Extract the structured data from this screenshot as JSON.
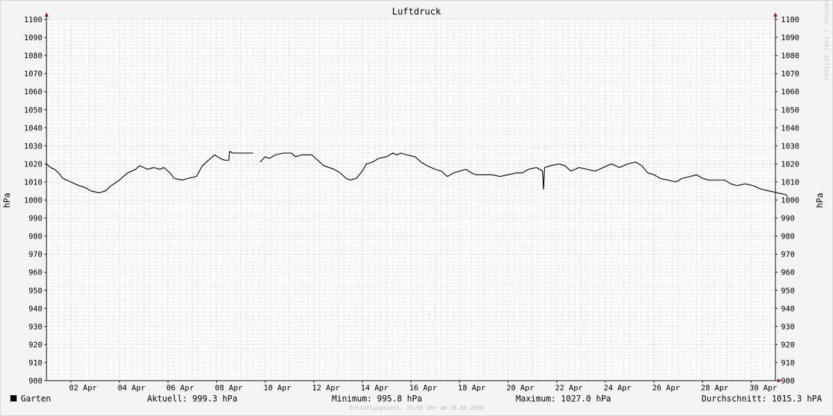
{
  "chart_data": {
    "type": "line",
    "title": "Luftdruck",
    "ylabel": "hPa",
    "ylim": [
      900,
      1100
    ],
    "yticks": [
      900,
      910,
      920,
      930,
      940,
      950,
      960,
      970,
      980,
      990,
      1000,
      1010,
      1020,
      1030,
      1040,
      1050,
      1060,
      1070,
      1080,
      1090,
      1100
    ],
    "x_range_days": [
      "2020-04-01",
      "2020-05-01"
    ],
    "xticks": [
      {
        "day": "2020-04-02",
        "label": "02 Apr"
      },
      {
        "day": "2020-04-04",
        "label": "04 Apr"
      },
      {
        "day": "2020-04-06",
        "label": "06 Apr"
      },
      {
        "day": "2020-04-08",
        "label": "08 Apr"
      },
      {
        "day": "2020-04-10",
        "label": "10 Apr"
      },
      {
        "day": "2020-04-12",
        "label": "12 Apr"
      },
      {
        "day": "2020-04-14",
        "label": "14 Apr"
      },
      {
        "day": "2020-04-16",
        "label": "16 Apr"
      },
      {
        "day": "2020-04-18",
        "label": "18 Apr"
      },
      {
        "day": "2020-04-20",
        "label": "20 Apr"
      },
      {
        "day": "2020-04-22",
        "label": "22 Apr"
      },
      {
        "day": "2020-04-24",
        "label": "24 Apr"
      },
      {
        "day": "2020-04-26",
        "label": "26 Apr"
      },
      {
        "day": "2020-04-28",
        "label": "28 Apr"
      },
      {
        "day": "2020-04-30",
        "label": "30 Apr"
      }
    ],
    "grid": true,
    "series": [
      {
        "name": "Garten",
        "color": "#000000",
        "segments": [
          [
            [
              "2020-04-01 00:00",
              1020
            ],
            [
              "2020-04-01 04:00",
              1018
            ],
            [
              "2020-04-01 08:00",
              1017
            ],
            [
              "2020-04-01 12:00",
              1015
            ],
            [
              "2020-04-01 16:00",
              1012
            ],
            [
              "2020-04-02 00:00",
              1010
            ],
            [
              "2020-04-02 08:00",
              1008
            ],
            [
              "2020-04-02 14:00",
              1007
            ],
            [
              "2020-04-02 20:00",
              1005
            ],
            [
              "2020-04-03 04:00",
              1004
            ],
            [
              "2020-04-03 10:00",
              1005
            ],
            [
              "2020-04-03 16:00",
              1008
            ],
            [
              "2020-04-04 00:00",
              1011
            ],
            [
              "2020-04-04 08:00",
              1015
            ],
            [
              "2020-04-04 16:00",
              1017
            ],
            [
              "2020-04-04 20:00",
              1019
            ],
            [
              "2020-04-05 04:00",
              1017
            ],
            [
              "2020-04-05 10:00",
              1018
            ],
            [
              "2020-04-05 16:00",
              1017
            ],
            [
              "2020-04-05 20:00",
              1018
            ],
            [
              "2020-04-06 02:00",
              1015
            ],
            [
              "2020-04-06 06:00",
              1012
            ],
            [
              "2020-04-06 14:00",
              1011
            ],
            [
              "2020-04-06 20:00",
              1012
            ],
            [
              "2020-04-07 04:00",
              1013
            ],
            [
              "2020-04-07 10:00",
              1019
            ],
            [
              "2020-04-07 16:00",
              1022
            ],
            [
              "2020-04-07 22:00",
              1025
            ],
            [
              "2020-04-08 04:00",
              1023
            ],
            [
              "2020-04-08 08:00",
              1022
            ],
            [
              "2020-04-08 12:00",
              1022
            ],
            [
              "2020-04-08 13:00",
              1027
            ],
            [
              "2020-04-08 16:00",
              1026
            ],
            [
              "2020-04-09 12:00",
              1026
            ]
          ],
          [
            [
              "2020-04-09 19:00",
              1021
            ],
            [
              "2020-04-10 00:00",
              1024
            ],
            [
              "2020-04-10 04:00",
              1023
            ],
            [
              "2020-04-10 10:00",
              1025
            ],
            [
              "2020-04-10 18:00",
              1026
            ],
            [
              "2020-04-11 02:00",
              1026
            ],
            [
              "2020-04-11 06:00",
              1024
            ],
            [
              "2020-04-11 12:00",
              1025
            ],
            [
              "2020-04-11 22:00",
              1025
            ],
            [
              "2020-04-12 04:00",
              1022
            ],
            [
              "2020-04-12 10:00",
              1019
            ],
            [
              "2020-04-12 20:00",
              1017
            ],
            [
              "2020-04-13 02:00",
              1015
            ],
            [
              "2020-04-13 08:00",
              1012
            ],
            [
              "2020-04-13 12:00",
              1011
            ],
            [
              "2020-04-13 18:00",
              1012
            ],
            [
              "2020-04-14 00:00",
              1016
            ],
            [
              "2020-04-14 04:00",
              1020
            ],
            [
              "2020-04-14 10:00",
              1021
            ],
            [
              "2020-04-14 16:00",
              1023
            ],
            [
              "2020-04-15 00:00",
              1024
            ],
            [
              "2020-04-15 06:00",
              1026
            ],
            [
              "2020-04-15 10:00",
              1025
            ],
            [
              "2020-04-15 14:00",
              1026
            ],
            [
              "2020-04-15 20:00",
              1025
            ],
            [
              "2020-04-16 04:00",
              1024
            ],
            [
              "2020-04-16 10:00",
              1021
            ],
            [
              "2020-04-16 16:00",
              1019
            ],
            [
              "2020-04-17 00:00",
              1017
            ],
            [
              "2020-04-17 06:00",
              1016
            ],
            [
              "2020-04-17 12:00",
              1013
            ],
            [
              "2020-04-17 18:00",
              1015
            ],
            [
              "2020-04-18 00:00",
              1016
            ],
            [
              "2020-04-18 06:00",
              1017
            ],
            [
              "2020-04-18 12:00",
              1015
            ],
            [
              "2020-04-18 16:00",
              1014
            ],
            [
              "2020-04-19 00:00",
              1014
            ],
            [
              "2020-04-19 08:00",
              1014
            ],
            [
              "2020-04-19 16:00",
              1013
            ],
            [
              "2020-04-20 00:00",
              1014
            ],
            [
              "2020-04-20 08:00",
              1015
            ],
            [
              "2020-04-20 14:00",
              1015
            ],
            [
              "2020-04-20 20:00",
              1017
            ],
            [
              "2020-04-21 04:00",
              1018
            ],
            [
              "2020-04-21 10:00",
              1016
            ],
            [
              "2020-04-21 11:00",
              1006
            ],
            [
              "2020-04-21 12:00",
              1018
            ],
            [
              "2020-04-21 18:00",
              1019
            ],
            [
              "2020-04-22 02:00",
              1020
            ],
            [
              "2020-04-22 08:00",
              1019
            ],
            [
              "2020-04-22 14:00",
              1016
            ],
            [
              "2020-04-22 22:00",
              1018
            ],
            [
              "2020-04-23 06:00",
              1017
            ],
            [
              "2020-04-23 14:00",
              1016
            ],
            [
              "2020-04-23 22:00",
              1018
            ],
            [
              "2020-04-24 06:00",
              1020
            ],
            [
              "2020-04-24 14:00",
              1018
            ],
            [
              "2020-04-24 22:00",
              1020
            ],
            [
              "2020-04-25 06:00",
              1021
            ],
            [
              "2020-04-25 12:00",
              1019
            ],
            [
              "2020-04-25 18:00",
              1015
            ],
            [
              "2020-04-26 00:00",
              1014
            ],
            [
              "2020-04-26 06:00",
              1012
            ],
            [
              "2020-04-26 14:00",
              1011
            ],
            [
              "2020-04-26 22:00",
              1010
            ],
            [
              "2020-04-27 04:00",
              1012
            ],
            [
              "2020-04-27 12:00",
              1013
            ],
            [
              "2020-04-27 18:00",
              1014
            ],
            [
              "2020-04-28 00:00",
              1012
            ],
            [
              "2020-04-28 06:00",
              1011
            ],
            [
              "2020-04-28 14:00",
              1011
            ],
            [
              "2020-04-28 22:00",
              1011
            ],
            [
              "2020-04-29 04:00",
              1009
            ],
            [
              "2020-04-29 10:00",
              1008
            ],
            [
              "2020-04-29 18:00",
              1009
            ],
            [
              "2020-04-30 02:00",
              1008
            ],
            [
              "2020-04-30 10:00",
              1006
            ],
            [
              "2020-04-30 18:00",
              1005
            ],
            [
              "2020-05-01 02:00",
              1004
            ],
            [
              "2020-05-01 10:00",
              1003
            ],
            [
              "2020-05-01 12:00",
              1002
            ]
          ]
        ]
      }
    ]
  },
  "legend": {
    "series_name": "Garten",
    "current": "Aktuell: 999.3 hPa",
    "minimum": "Minimum: 995.8 hPa",
    "maximum": "Maximum: 1027.0 hPa",
    "average": "Durchschnitt: 1015.3 hPA"
  },
  "watermark": "RRDTOOL / TOBI OETIKER",
  "footer": "Erstellungszeit: 23:55 Uhr am 30.04.2020",
  "colors": {
    "background": "#f4f4f4",
    "plot_background": "#ffffff",
    "minor_grid": "#b5b5b5",
    "major_grid": "#e6a3a3",
    "axis": "#000000",
    "arrow": "#a31c1c",
    "line": "#000000"
  }
}
